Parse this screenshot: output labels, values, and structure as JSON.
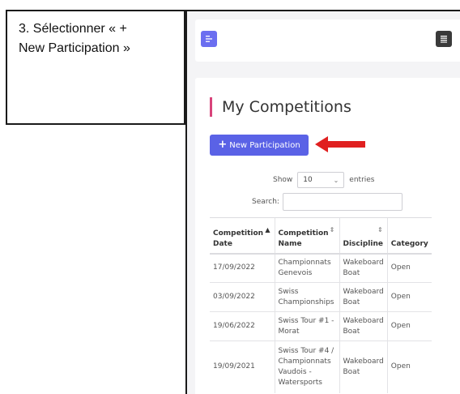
{
  "instruction": {
    "line1": "3. Sélectionner « +",
    "line2": "New Participation »"
  },
  "page": {
    "title": "My Competitions",
    "new_button_label": "New Participation",
    "accent_color": "#5a62e6"
  },
  "table_controls": {
    "show_label": "Show",
    "show_value": "10",
    "entries_label": "entries",
    "search_label": "Search:"
  },
  "table": {
    "headers": [
      {
        "line1": "Competition",
        "line2": "Date"
      },
      {
        "line1": "Competition",
        "line2": "Name"
      },
      {
        "line1": "",
        "line2": "Discipline"
      },
      {
        "line1": "",
        "line2": "Category"
      }
    ],
    "rows": [
      {
        "date": "17/09/2022",
        "name": [
          "Championnats",
          "Genevois"
        ],
        "discipline": [
          "Wakeboard",
          "Boat"
        ],
        "category": "Open"
      },
      {
        "date": "03/09/2022",
        "name": [
          "Swiss",
          "Championships"
        ],
        "discipline": [
          "Wakeboard",
          "Boat"
        ],
        "category": "Open"
      },
      {
        "date": "19/06/2022",
        "name": [
          "Swiss Tour #1 -",
          "Morat"
        ],
        "discipline": [
          "Wakeboard",
          "Boat"
        ],
        "category": "Open"
      },
      {
        "date": "19/09/2021",
        "name": [
          "Swiss Tour #4 /",
          "Championnats",
          "Vaudois -",
          "Watersports"
        ],
        "discipline": [
          "Wakeboard",
          "Boat"
        ],
        "category": "Open"
      }
    ]
  }
}
